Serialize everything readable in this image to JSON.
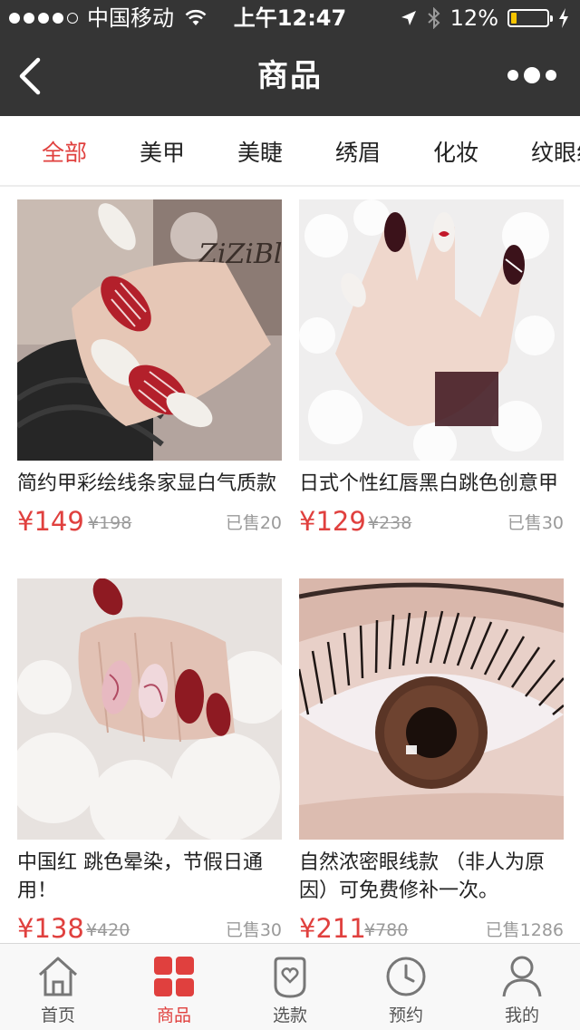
{
  "status_bar": {
    "carrier": "中国移动",
    "time": "上午12:47",
    "battery": "12%"
  },
  "nav": {
    "title": "商品"
  },
  "categories": [
    {
      "label": "全部",
      "active": true
    },
    {
      "label": "美甲",
      "active": false
    },
    {
      "label": "美睫",
      "active": false
    },
    {
      "label": "绣眉",
      "active": false
    },
    {
      "label": "化妆",
      "active": false
    },
    {
      "label": "纹眼线",
      "active": false
    }
  ],
  "products": [
    {
      "name": "简约甲彩绘线条家显白气质款",
      "price": "¥149",
      "old_price": "¥198",
      "sold": "已售20"
    },
    {
      "name": "日式个性红唇黑白跳色创意甲",
      "price": "¥129",
      "old_price": "¥238",
      "sold": "已售30"
    },
    {
      "name": "中国红 跳色晕染，节假日通用！",
      "price": "¥138",
      "old_price": "¥420",
      "sold": "已售30"
    },
    {
      "name": "自然浓密眼线款 （非人为原因）可免费修补一次。",
      "price": "¥211",
      "old_price": "¥780",
      "sold": "已售1286"
    }
  ],
  "tabbar": [
    {
      "label": "首页",
      "icon": "home-icon",
      "active": false
    },
    {
      "label": "商品",
      "icon": "grid-icon",
      "active": true
    },
    {
      "label": "选款",
      "icon": "heart-tag-icon",
      "active": false
    },
    {
      "label": "预约",
      "icon": "clock-icon",
      "active": false
    },
    {
      "label": "我的",
      "icon": "person-icon",
      "active": false
    }
  ],
  "colors": {
    "accent": "#e0403e",
    "header_bg": "#353535",
    "battery_fill": "#f5c400"
  }
}
